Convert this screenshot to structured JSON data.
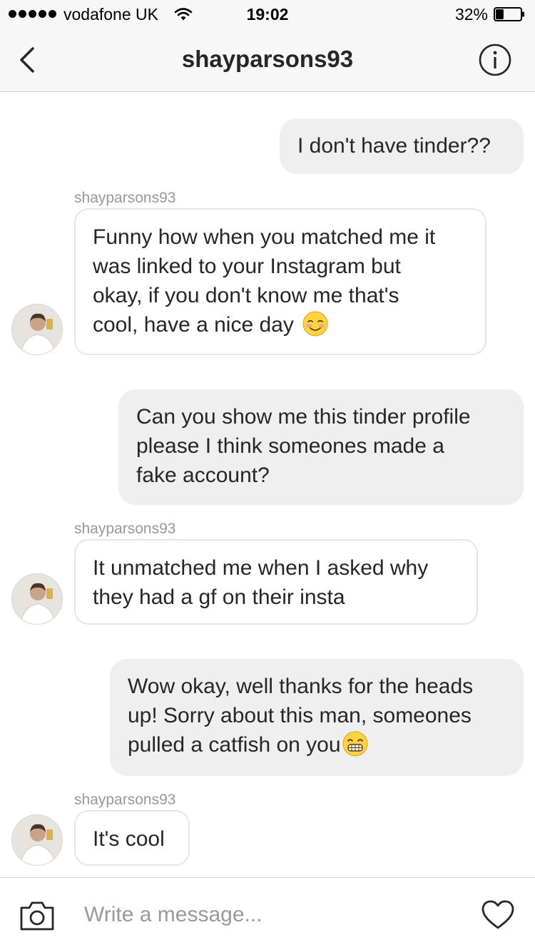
{
  "status_bar": {
    "carrier": "vodafone UK",
    "time": "19:02",
    "battery": "32%",
    "battery_level": 0.32
  },
  "header": {
    "title": "shayparsons93",
    "back_icon": "chevron-left-icon",
    "info_icon": "info-icon"
  },
  "messages": [
    {
      "from": "me",
      "text": "I don't have tinder??"
    },
    {
      "from": "them",
      "sender": "shayparsons93",
      "lines": [
        "Funny how when you matched me it",
        "was linked to your Instagram but",
        "okay, if you don't know me that's",
        "cool, have a nice day"
      ],
      "emoji": "smiling-blush-emoji"
    },
    {
      "from": "me",
      "lines": [
        "Can you show me this tinder profile",
        "please I think someones made a",
        "fake account?"
      ]
    },
    {
      "from": "them",
      "sender": "shayparsons93",
      "lines": [
        "It unmatched me when I asked why",
        "they had a gf on their insta"
      ]
    },
    {
      "from": "me",
      "lines": [
        "Wow okay, well thanks for the heads",
        "up! Sorry about this man, someones",
        "pulled a catfish on you"
      ],
      "emoji": "grimacing-emoji"
    },
    {
      "from": "them",
      "sender": "shayparsons93",
      "text": "It's cool"
    }
  ],
  "composer": {
    "placeholder": "Write a message...",
    "camera_icon": "camera-icon",
    "heart_icon": "heart-icon"
  },
  "colors": {
    "bar_bg": "#f7f7f7",
    "outgoing_bubble": "#efefef",
    "incoming_border": "#e6e6e6",
    "text": "#262626",
    "muted": "#999999"
  }
}
